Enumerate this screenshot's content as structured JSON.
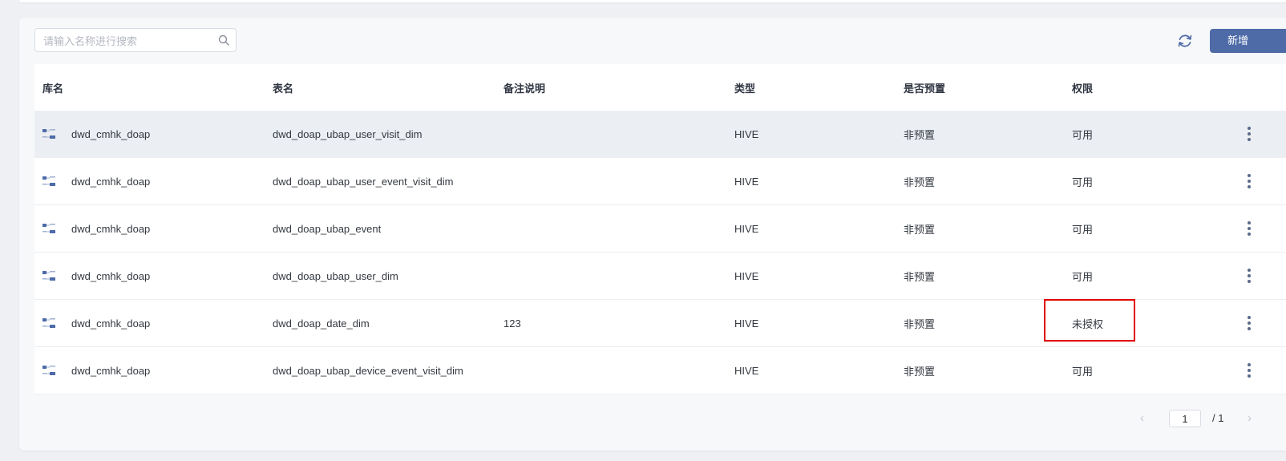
{
  "toolbar": {
    "search_placeholder": "请输入名称进行搜索",
    "search_value": "",
    "add_label": "新增"
  },
  "table": {
    "columns": [
      "库名",
      "表名",
      "备注说明",
      "类型",
      "是否预置",
      "权限"
    ],
    "rows": [
      {
        "db": "dwd_cmhk_doap",
        "table": "dwd_doap_ubap_user_visit_dim",
        "remark": "",
        "type": "HIVE",
        "preset": "非预置",
        "permission": "可用"
      },
      {
        "db": "dwd_cmhk_doap",
        "table": "dwd_doap_ubap_user_event_visit_dim",
        "remark": "",
        "type": "HIVE",
        "preset": "非预置",
        "permission": "可用"
      },
      {
        "db": "dwd_cmhk_doap",
        "table": "dwd_doap_ubap_event",
        "remark": "",
        "type": "HIVE",
        "preset": "非预置",
        "permission": "可用"
      },
      {
        "db": "dwd_cmhk_doap",
        "table": "dwd_doap_ubap_user_dim",
        "remark": "",
        "type": "HIVE",
        "preset": "非预置",
        "permission": "可用"
      },
      {
        "db": "dwd_cmhk_doap",
        "table": "dwd_doap_date_dim",
        "remark": "123",
        "type": "HIVE",
        "preset": "非预置",
        "permission": "未授权"
      },
      {
        "db": "dwd_cmhk_doap",
        "table": "dwd_doap_ubap_device_event_visit_dim",
        "remark": "",
        "type": "HIVE",
        "preset": "非预置",
        "permission": "可用"
      }
    ]
  },
  "pagination": {
    "current_page": "1",
    "total_label": "/  1"
  },
  "icons": {
    "search": "search-icon",
    "refresh": "refresh-icon",
    "database": "database-table-icon",
    "more": "more-vertical-icon",
    "prev": "chevron-left-icon",
    "next": "chevron-right-icon"
  },
  "colors": {
    "accent": "#4e6ba8",
    "highlight_border": "#e00000",
    "row_hover": "#ebeef2"
  }
}
